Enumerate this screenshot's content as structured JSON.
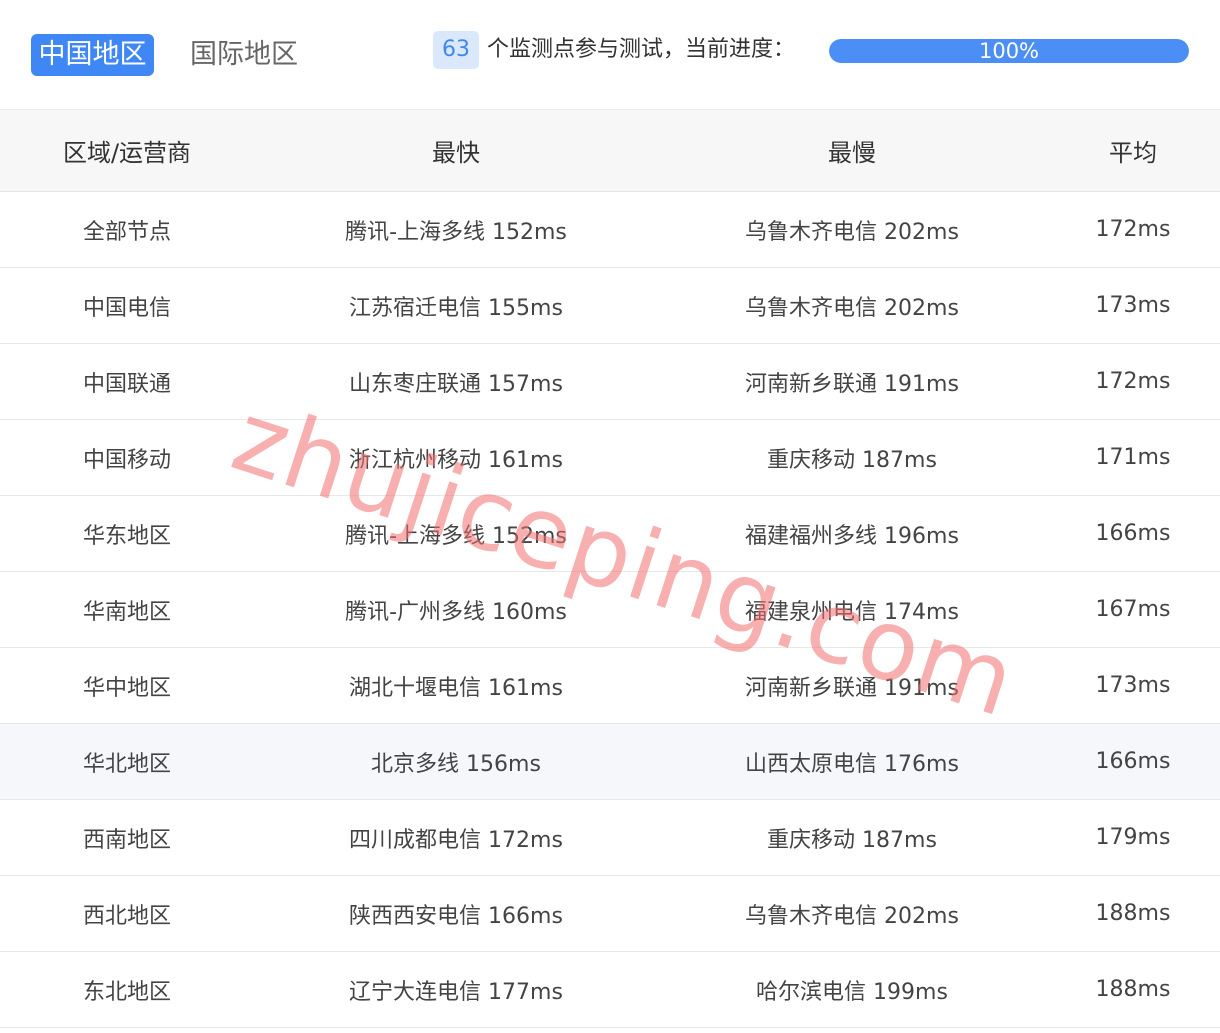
{
  "tabs": [
    {
      "label": "中国地区",
      "active": true
    },
    {
      "label": "国际地区",
      "active": false
    }
  ],
  "monitor": {
    "count": "63",
    "text": "个监测点参与测试，当前进度：",
    "progress_label": "100%",
    "progress_percent": 100
  },
  "table": {
    "headers": [
      "区域/运营商",
      "最快",
      "最慢",
      "平均"
    ],
    "rows": [
      {
        "region": "全部节点",
        "fastest": "腾讯-上海多线 152ms",
        "slowest": "乌鲁木齐电信 202ms",
        "average": "172ms"
      },
      {
        "region": "中国电信",
        "fastest": "江苏宿迁电信 155ms",
        "slowest": "乌鲁木齐电信 202ms",
        "average": "173ms"
      },
      {
        "region": "中国联通",
        "fastest": "山东枣庄联通 157ms",
        "slowest": "河南新乡联通 191ms",
        "average": "172ms"
      },
      {
        "region": "中国移动",
        "fastest": "浙江杭州移动 161ms",
        "slowest": "重庆移动 187ms",
        "average": "171ms"
      },
      {
        "region": "华东地区",
        "fastest": "腾讯-上海多线 152ms",
        "slowest": "福建福州多线 196ms",
        "average": "166ms"
      },
      {
        "region": "华南地区",
        "fastest": "腾讯-广州多线 160ms",
        "slowest": "福建泉州电信 174ms",
        "average": "167ms"
      },
      {
        "region": "华中地区",
        "fastest": "湖北十堰电信 161ms",
        "slowest": "河南新乡联通 191ms",
        "average": "173ms"
      },
      {
        "region": "华北地区",
        "fastest": "北京多线 156ms",
        "slowest": "山西太原电信 176ms",
        "average": "166ms"
      },
      {
        "region": "西南地区",
        "fastest": "四川成都电信 172ms",
        "slowest": "重庆移动 187ms",
        "average": "179ms"
      },
      {
        "region": "西北地区",
        "fastest": "陕西西安电信 166ms",
        "slowest": "乌鲁木齐电信 202ms",
        "average": "188ms"
      },
      {
        "region": "东北地区",
        "fastest": "辽宁大连电信 177ms",
        "slowest": "哈尔滨电信 199ms",
        "average": "188ms"
      }
    ]
  },
  "watermark": "zhujiceping.com",
  "colors": {
    "accent": "#3f87f5",
    "badge_bg": "#dbe8fb",
    "progress_fill": "#4b8ef6",
    "header_bg": "#f7f7f7",
    "watermark": "#f06e6e"
  }
}
